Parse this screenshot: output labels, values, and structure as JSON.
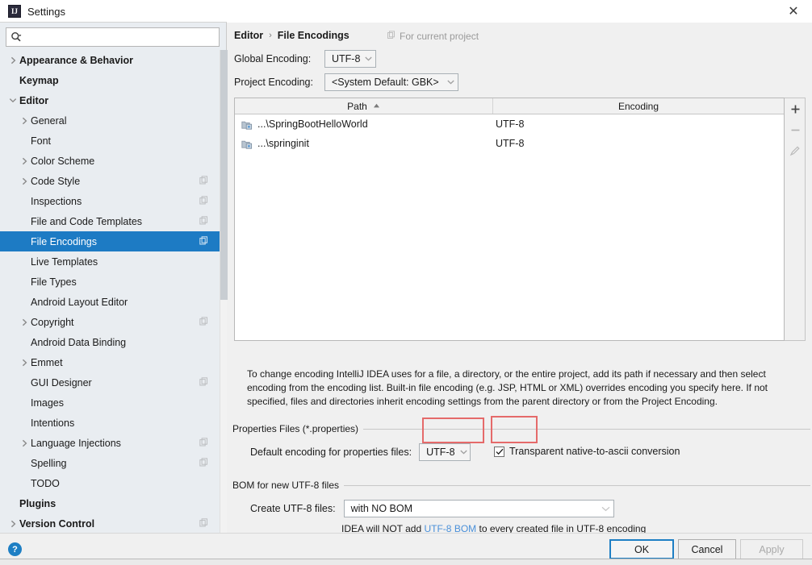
{
  "window": {
    "title": "Settings",
    "icon": "intellij-idea-icon",
    "close_label": "✕"
  },
  "search": {
    "placeholder": "",
    "value": "",
    "icon": "search-icon"
  },
  "sidebar": {
    "items": [
      {
        "label": "Appearance & Behavior",
        "bold": true,
        "indent": 0,
        "arrow": "right",
        "copy": false,
        "selected": false
      },
      {
        "label": "Keymap",
        "bold": true,
        "indent": 0,
        "arrow": "none",
        "copy": false,
        "selected": false
      },
      {
        "label": "Editor",
        "bold": true,
        "indent": 0,
        "arrow": "down",
        "copy": false,
        "selected": false
      },
      {
        "label": "General",
        "bold": false,
        "indent": 1,
        "arrow": "right",
        "copy": false,
        "selected": false
      },
      {
        "label": "Font",
        "bold": false,
        "indent": 1,
        "arrow": "none",
        "copy": false,
        "selected": false
      },
      {
        "label": "Color Scheme",
        "bold": false,
        "indent": 1,
        "arrow": "right",
        "copy": false,
        "selected": false
      },
      {
        "label": "Code Style",
        "bold": false,
        "indent": 1,
        "arrow": "right",
        "copy": true,
        "selected": false
      },
      {
        "label": "Inspections",
        "bold": false,
        "indent": 1,
        "arrow": "none",
        "copy": true,
        "selected": false
      },
      {
        "label": "File and Code Templates",
        "bold": false,
        "indent": 1,
        "arrow": "none",
        "copy": true,
        "selected": false
      },
      {
        "label": "File Encodings",
        "bold": false,
        "indent": 1,
        "arrow": "none",
        "copy": true,
        "selected": true
      },
      {
        "label": "Live Templates",
        "bold": false,
        "indent": 1,
        "arrow": "none",
        "copy": false,
        "selected": false
      },
      {
        "label": "File Types",
        "bold": false,
        "indent": 1,
        "arrow": "none",
        "copy": false,
        "selected": false
      },
      {
        "label": "Android Layout Editor",
        "bold": false,
        "indent": 1,
        "arrow": "none",
        "copy": false,
        "selected": false
      },
      {
        "label": "Copyright",
        "bold": false,
        "indent": 1,
        "arrow": "right",
        "copy": true,
        "selected": false
      },
      {
        "label": "Android Data Binding",
        "bold": false,
        "indent": 1,
        "arrow": "none",
        "copy": false,
        "selected": false
      },
      {
        "label": "Emmet",
        "bold": false,
        "indent": 1,
        "arrow": "right",
        "copy": false,
        "selected": false
      },
      {
        "label": "GUI Designer",
        "bold": false,
        "indent": 1,
        "arrow": "none",
        "copy": true,
        "selected": false
      },
      {
        "label": "Images",
        "bold": false,
        "indent": 1,
        "arrow": "none",
        "copy": false,
        "selected": false
      },
      {
        "label": "Intentions",
        "bold": false,
        "indent": 1,
        "arrow": "none",
        "copy": false,
        "selected": false
      },
      {
        "label": "Language Injections",
        "bold": false,
        "indent": 1,
        "arrow": "right",
        "copy": true,
        "selected": false
      },
      {
        "label": "Spelling",
        "bold": false,
        "indent": 1,
        "arrow": "none",
        "copy": true,
        "selected": false
      },
      {
        "label": "TODO",
        "bold": false,
        "indent": 1,
        "arrow": "none",
        "copy": false,
        "selected": false
      },
      {
        "label": "Plugins",
        "bold": true,
        "indent": 0,
        "arrow": "none",
        "copy": false,
        "selected": false
      },
      {
        "label": "Version Control",
        "bold": true,
        "indent": 0,
        "arrow": "right",
        "copy": true,
        "selected": false
      }
    ]
  },
  "content": {
    "breadcrumb": {
      "parent": "Editor",
      "separator": "›",
      "current": "File Encodings"
    },
    "for_current_project": "For current project",
    "global_encoding": {
      "label": "Global Encoding:",
      "value": "UTF-8"
    },
    "project_encoding": {
      "label": "Project Encoding:",
      "value": "<System Default: GBK>"
    },
    "table": {
      "columns": [
        "Path",
        "Encoding"
      ],
      "sort_column": "Path",
      "sort_direction": "asc",
      "rows": [
        {
          "path": "...\\SpringBootHelloWorld",
          "encoding": "UTF-8"
        },
        {
          "path": "...\\springinit",
          "encoding": "UTF-8"
        }
      ],
      "buttons": [
        {
          "name": "add-row-button",
          "glyph": "+",
          "enabled": true
        },
        {
          "name": "remove-row-button",
          "glyph": "−",
          "enabled": false
        },
        {
          "name": "edit-row-button",
          "glyph": "✎",
          "enabled": false
        }
      ]
    },
    "description": "To change encoding IntelliJ IDEA uses for a file, a directory, or the entire project, add its path if necessary and then select encoding from the encoding list. Built-in file encoding (e.g. JSP, HTML or XML) overrides encoding you specify here. If not specified, files and directories inherit encoding settings from the parent directory or from the Project Encoding.",
    "properties_group": {
      "title": "Properties Files (*.properties)",
      "default_encoding_label": "Default encoding for properties files:",
      "default_encoding_value": "UTF-8",
      "checkbox_label": "Transparent native-to-ascii conversion",
      "checkbox_checked": true
    },
    "bom_group": {
      "title": "BOM for new UTF-8 files",
      "create_label": "Create UTF-8 files:",
      "create_value": "with NO BOM",
      "hint_prefix": "IDEA will NOT add ",
      "hint_link": "UTF-8 BOM",
      "hint_suffix": " to every created file in UTF-8 encoding"
    }
  },
  "footer": {
    "help_glyph": "?",
    "ok": "OK",
    "cancel": "Cancel",
    "apply": "Apply",
    "apply_enabled": false
  },
  "colors": {
    "selection": "#1d7bc4",
    "link": "#4a90d9",
    "annotation": "#e56a6a",
    "sidebar_bg": "#e9edf1",
    "content_bg": "#f0f0f0"
  }
}
